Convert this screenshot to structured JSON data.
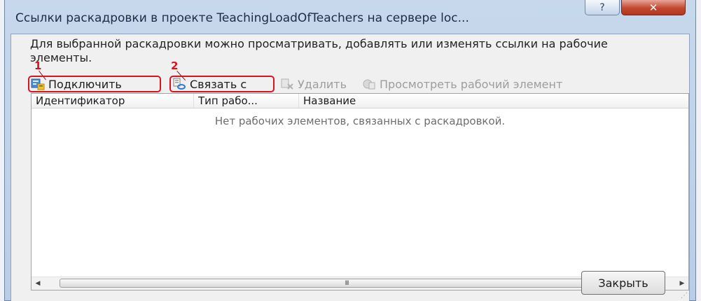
{
  "window": {
    "title": "Ссылки раскадровки в проекте TeachingLoadOfTeachers на сервере loc...",
    "help_label": "?",
    "close_label": "✕"
  },
  "description": "Для выбранной раскадровки можно просматривать, добавлять или изменять ссылки на рабочие элементы.",
  "callouts": [
    "1",
    "2"
  ],
  "toolbar": {
    "connect_label": "Подключить",
    "link_label": "Связать с",
    "delete_label": "Удалить",
    "view_label": "Просмотреть рабочий элемент"
  },
  "grid": {
    "columns": [
      "Идентификатор",
      "Тип рабо...",
      "Название"
    ],
    "empty_message": "Нет рабочих элементов, связанных с раскадровкой.",
    "scroll_grip": "III"
  },
  "footer": {
    "close_button_label": "Закрыть"
  },
  "colors": {
    "callout": "#d8141f",
    "title_bar": "#c7d8ec",
    "close_button": "#c3472f"
  },
  "icons": [
    "help-icon",
    "close-icon",
    "connect-icon",
    "link-icon",
    "delete-icon",
    "view-work-item-icon",
    "scroll-left-icon",
    "scroll-right-icon",
    "resize-grip-icon"
  ]
}
